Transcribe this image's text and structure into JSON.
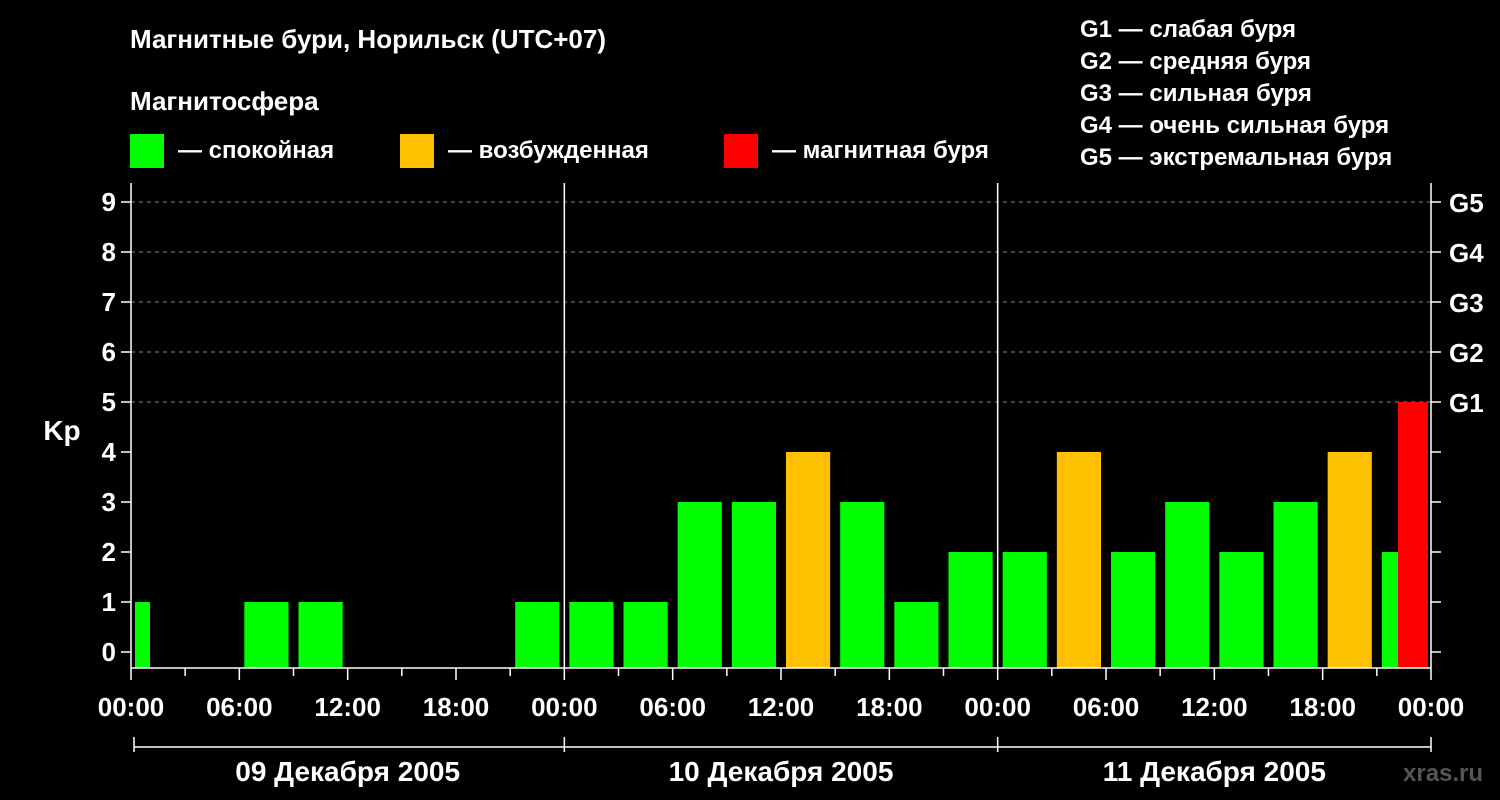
{
  "title": "Магнитные бури, Норильск (UTC+07)",
  "subtitle": "Магнитосфера",
  "legend": [
    {
      "label": "— спокойная",
      "color": "#00ff00"
    },
    {
      "label": "— возбужденная",
      "color": "#ffc000"
    },
    {
      "label": "— магнитная буря",
      "color": "#ff0000"
    }
  ],
  "storm_levels": [
    "G1 — слабая буря",
    "G2 — средняя буря",
    "G3 — сильная буря",
    "G4 — очень сильная буря",
    "G5 — экстремальная буря"
  ],
  "watermark": "xras.ru",
  "chart_data": {
    "type": "bar",
    "ylabel": "Kp",
    "ylim": [
      0,
      9
    ],
    "yticks": [
      "0",
      "1",
      "2",
      "3",
      "4",
      "5",
      "6",
      "7",
      "8",
      "9"
    ],
    "right_ticks": [
      {
        "value": 5,
        "label": "G1"
      },
      {
        "value": 6,
        "label": "G2"
      },
      {
        "value": 7,
        "label": "G3"
      },
      {
        "value": 8,
        "label": "G4"
      },
      {
        "value": 9,
        "label": "G5"
      }
    ],
    "xtick_labels": [
      "00:00",
      "06:00",
      "12:00",
      "18:00",
      "00:00",
      "06:00",
      "12:00",
      "18:00",
      "00:00",
      "06:00",
      "12:00",
      "18:00",
      "00:00"
    ],
    "days": [
      "09 Декабря 2005",
      "10 Декабря 2005",
      "11 Декабря 2005"
    ],
    "grid": true,
    "bars": [
      {
        "day": 0,
        "start_hour": 0,
        "value": 1,
        "status": "quiet",
        "partial": true
      },
      {
        "day": 0,
        "start_hour": 3,
        "value": 0,
        "status": "quiet"
      },
      {
        "day": 0,
        "start_hour": 6,
        "value": 1,
        "status": "quiet"
      },
      {
        "day": 0,
        "start_hour": 9,
        "value": 1,
        "status": "quiet"
      },
      {
        "day": 0,
        "start_hour": 12,
        "value": 0,
        "status": "quiet"
      },
      {
        "day": 0,
        "start_hour": 15,
        "value": 0,
        "status": "quiet"
      },
      {
        "day": 0,
        "start_hour": 18,
        "value": 0,
        "status": "quiet"
      },
      {
        "day": 0,
        "start_hour": 21,
        "value": 1,
        "status": "quiet"
      },
      {
        "day": 1,
        "start_hour": 0,
        "value": 1,
        "status": "quiet"
      },
      {
        "day": 1,
        "start_hour": 3,
        "value": 1,
        "status": "quiet"
      },
      {
        "day": 1,
        "start_hour": 6,
        "value": 3,
        "status": "quiet"
      },
      {
        "day": 1,
        "start_hour": 9,
        "value": 3,
        "status": "quiet"
      },
      {
        "day": 1,
        "start_hour": 12,
        "value": 4,
        "status": "active"
      },
      {
        "day": 1,
        "start_hour": 15,
        "value": 3,
        "status": "quiet"
      },
      {
        "day": 1,
        "start_hour": 18,
        "value": 1,
        "status": "quiet"
      },
      {
        "day": 1,
        "start_hour": 21,
        "value": 2,
        "status": "quiet"
      },
      {
        "day": 2,
        "start_hour": 0,
        "value": 2,
        "status": "quiet"
      },
      {
        "day": 2,
        "start_hour": 3,
        "value": 4,
        "status": "active"
      },
      {
        "day": 2,
        "start_hour": 6,
        "value": 2,
        "status": "quiet"
      },
      {
        "day": 2,
        "start_hour": 9,
        "value": 3,
        "status": "quiet"
      },
      {
        "day": 2,
        "start_hour": 12,
        "value": 2,
        "status": "quiet"
      },
      {
        "day": 2,
        "start_hour": 15,
        "value": 3,
        "status": "quiet"
      },
      {
        "day": 2,
        "start_hour": 18,
        "value": 4,
        "status": "active"
      },
      {
        "day": 2,
        "start_hour": 21,
        "value": 2,
        "status": "quiet"
      },
      {
        "day": 3,
        "start_hour": 0,
        "value": 5,
        "status": "storm",
        "partial": true
      }
    ],
    "colors": {
      "quiet": "#00ff00",
      "active": "#ffc000",
      "storm": "#ff0000"
    }
  }
}
